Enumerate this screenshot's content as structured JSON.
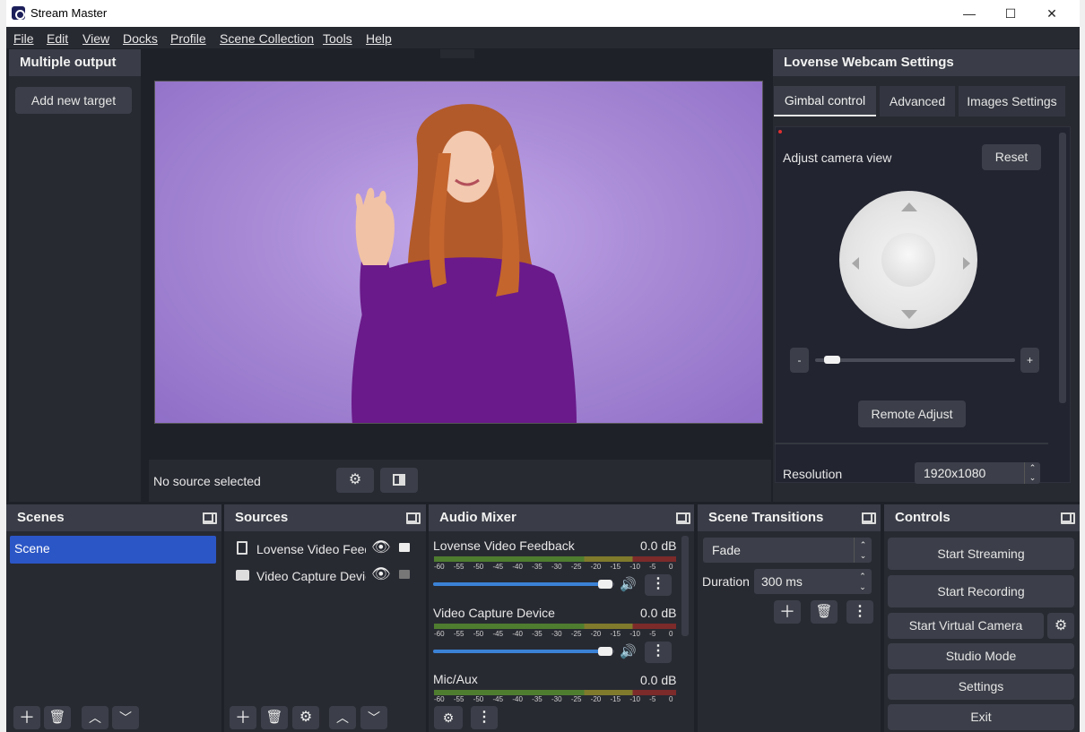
{
  "window": {
    "title": "Stream Master",
    "minimize": "—",
    "maximize": "☐",
    "close": "✕"
  },
  "menu": [
    "File",
    "Edit",
    "View",
    "Docks",
    "Profile",
    "Scene Collection",
    "Tools",
    "Help"
  ],
  "multiple_output": {
    "title": "Multiple output",
    "add_button": "Add new target"
  },
  "preview": {
    "status": "No source selected"
  },
  "lovense": {
    "title": "Lovense Webcam Settings",
    "tabs": [
      "Gimbal control",
      "Advanced",
      "Images Settings"
    ],
    "adjust_label": "Adjust camera view",
    "reset": "Reset",
    "minus": "-",
    "plus": "+",
    "remote_adjust": "Remote Adjust",
    "resolution_label": "Resolution",
    "resolution_value": "1920x1080",
    "zoom_level": 0.05
  },
  "scenes": {
    "title": "Scenes",
    "items": [
      "Scene"
    ]
  },
  "sources": {
    "title": "Sources",
    "items": [
      "Lovense Video Feed",
      "Video Capture Devic"
    ]
  },
  "audio_mixer": {
    "title": "Audio Mixer",
    "channels": [
      {
        "name": "Lovense Video Feedback",
        "db": "0.0 dB",
        "volume": 1.0
      },
      {
        "name": "Video Capture Device",
        "db": "0.0 dB",
        "volume": 1.0
      },
      {
        "name": "Mic/Aux",
        "db": "0.0 dB"
      }
    ],
    "ticks": [
      "-60",
      "-55",
      "-50",
      "-45",
      "-40",
      "-35",
      "-30",
      "-25",
      "-20",
      "-15",
      "-10",
      "-5",
      "0"
    ]
  },
  "transitions": {
    "title": "Scene Transitions",
    "selected": "Fade",
    "duration_label": "Duration",
    "duration_value": "300 ms"
  },
  "controls": {
    "title": "Controls",
    "start_streaming": "Start Streaming",
    "start_recording": "Start Recording",
    "start_virtual_camera": "Start Virtual Camera",
    "studio_mode": "Studio Mode",
    "settings": "Settings",
    "exit": "Exit"
  },
  "colors": {
    "accent": "#2b56c6",
    "background": "#1f2129",
    "panel": "#282a32",
    "preview_bg": "#a98bd6"
  }
}
